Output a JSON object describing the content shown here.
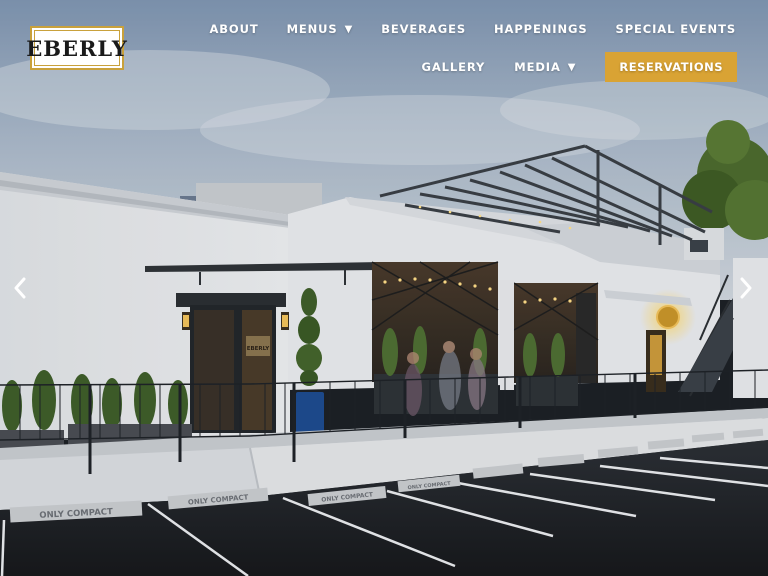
{
  "brand": {
    "logo_text": "EBERLY",
    "logo_border_color": "#c9a13b"
  },
  "nav": {
    "row1": [
      {
        "label": "ABOUT",
        "dropdown": false
      },
      {
        "label": "MENUS",
        "dropdown": true
      },
      {
        "label": "BEVERAGES",
        "dropdown": false
      },
      {
        "label": "HAPPENINGS",
        "dropdown": false
      },
      {
        "label": "SPECIAL EVENTS",
        "dropdown": false
      }
    ],
    "row2": [
      {
        "label": "GALLERY",
        "dropdown": false
      },
      {
        "label": "MEDIA",
        "dropdown": true
      }
    ],
    "cta": {
      "label": "RESERVATIONS",
      "color": "#d9a334"
    },
    "caret_glyph": "▼"
  },
  "hero": {
    "door_sign": "EBERLY",
    "parking_stencils": [
      "ONLY COMPACT",
      "ONLY COMPACT",
      "ONLY COMPACT",
      "ONLY COMPACT"
    ],
    "prev_icon": "chevron-left-icon",
    "next_icon": "chevron-right-icon"
  }
}
